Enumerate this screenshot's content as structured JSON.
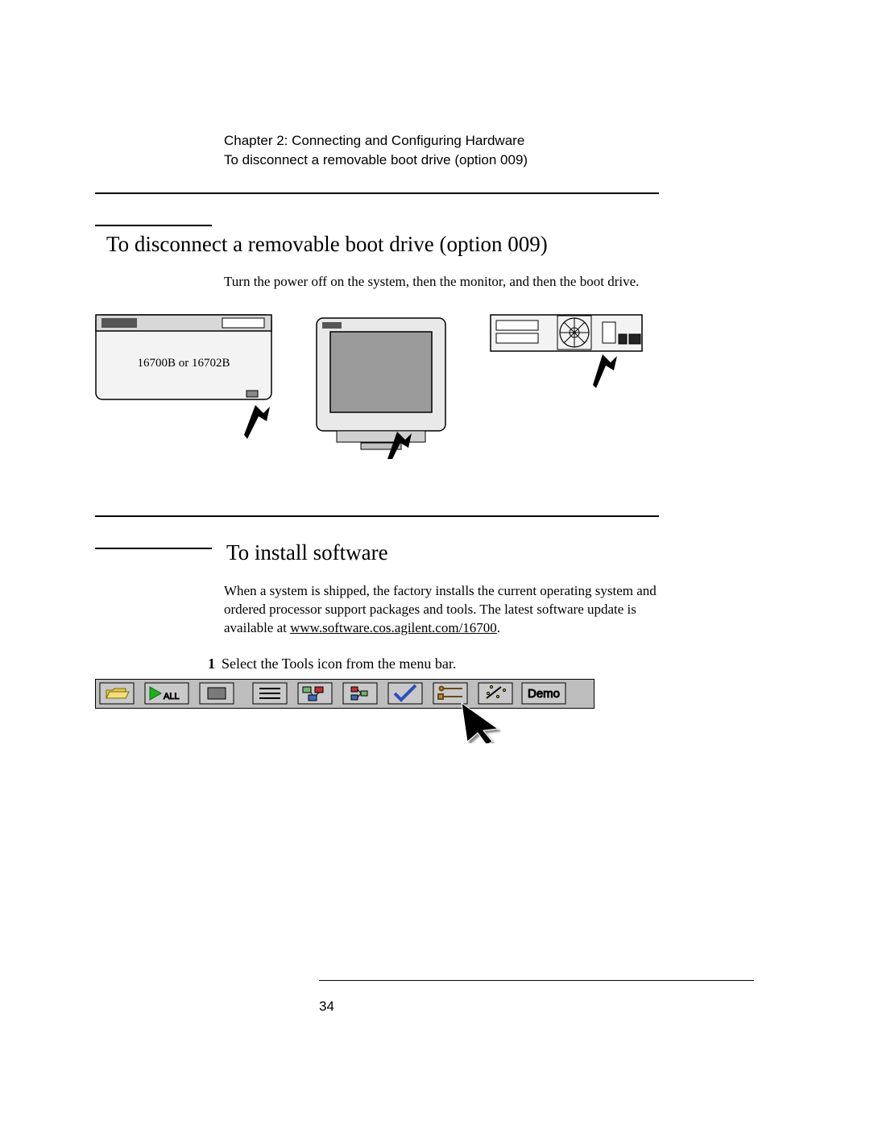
{
  "header": {
    "chapter": "Chapter 2: Connecting and Configuring Hardware",
    "subtitle": "To disconnect a removable boot drive (option 009)"
  },
  "section1": {
    "title": "To disconnect a removable boot drive (option 009)",
    "body": "Turn the power off on the system, then the monitor, and then the boot drive.",
    "device_label": "16700B or 16702B"
  },
  "section2": {
    "title": "To install software",
    "body_pre": "When a system is shipped, the factory installs the current operating system and ordered processor support packages and tools. The latest software update is available at ",
    "body_link": "www.software.cos.agilent.com/16700",
    "body_post": ".",
    "step_num": "1",
    "step_text": "Select the Tools icon from the menu bar."
  },
  "toolbar": {
    "all_label": "ALL",
    "demo_label": "Demo"
  },
  "page_number": "34"
}
